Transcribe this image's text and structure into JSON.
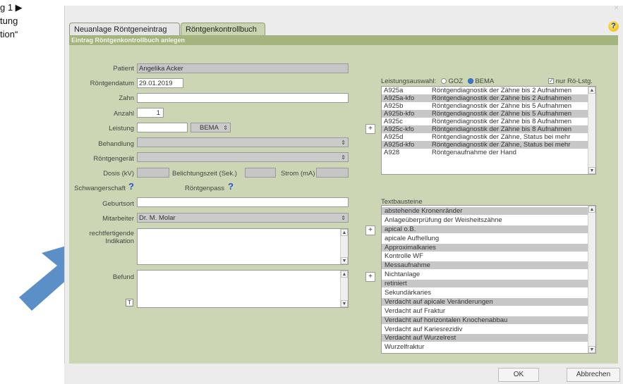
{
  "side_text": {
    "line1": "g 1 ▶",
    "line2": "tung",
    "line3": "tion“"
  },
  "window": {
    "close": "×",
    "help": "?"
  },
  "tabs": [
    {
      "label": "Neuanlage Röntgeneintrag"
    },
    {
      "label": "Röntgenkontrollbuch"
    }
  ],
  "panel_title": "Eintrag Röntgenkontrollbuch anlegen",
  "form": {
    "patient_label": "Patient",
    "patient_value": "Angelika Acker",
    "date_label": "Röntgendatum",
    "date_value": "29.01.2019",
    "zahn_label": "Zahn",
    "zahn_value": "",
    "anzahl_label": "Anzahl",
    "anzahl_value": "1",
    "leistung_label": "Leistung",
    "leistung_value": "",
    "leistung_catalog": "BEMA",
    "behandlung_label": "Behandlung",
    "geraet_label": "Röntgengerät",
    "dosis_label": "Dosis (kV)",
    "belichtung_label": "Belichtungszeit (Sek.)",
    "strom_label": "Strom (mA)",
    "schwanger_label": "Schwangerschaft",
    "pass_label": "Röntgenpass",
    "geburtsort_label": "Geburtsort",
    "geburtsort_value": "",
    "mitarbeiter_label": "Mitarbeiter",
    "mitarbeiter_value": "Dr. M. Molar",
    "indikation_label1": "rechtfertigende",
    "indikation_label2": "Indikation",
    "befund_label": "Befund",
    "t_button": "T",
    "arrow_symbol": "⇕",
    "question_symbol": "?",
    "plus_symbol": "+"
  },
  "leistungsauswahl": {
    "label": "Leistungsauswahl:",
    "goz": "GOZ",
    "bema": "BEMA",
    "filter": "nur Rö-Lstg.",
    "check_mark": "✓",
    "items": [
      {
        "code": "A925a",
        "desc": "Röntgendiagnostik der Zähne bis 2 Aufnahmen"
      },
      {
        "code": "A925a-kfo",
        "desc": "Röntgendiagnostik der Zähne bis 2 Aufnahmen"
      },
      {
        "code": "A925b",
        "desc": "Röntgendiagnostik der Zähne bis 5 Aufnahmen"
      },
      {
        "code": "A925b-kfo",
        "desc": "Röntgendiagnostik der Zähne bis 5 Aufnahmen"
      },
      {
        "code": "A925c",
        "desc": "Röntgendiagnostik der Zähne bis 8 Aufnahmen"
      },
      {
        "code": "A925c-kfo",
        "desc": "Röntgendiagnostik der Zähne bis 8 Aufnahmen"
      },
      {
        "code": "A925d",
        "desc": "Röntgendiagnostik der Zähne, Status bei mehr"
      },
      {
        "code": "A925d-kfo",
        "desc": "Röntgendiagnostik der Zähne, Status bei mehr"
      },
      {
        "code": "A928",
        "desc": "Röntgenaufnahme der Hand"
      }
    ]
  },
  "textbausteine": {
    "label": "Textbausteine",
    "items": [
      "abstehende Kronenränder",
      "Anlageüberprüfung der Weisheitszähne",
      "apical o.B.",
      "apicale Aufhellung",
      "Approximalkaries",
      "Kontrolle WF",
      "Messaufnahme",
      "Nichtanlage",
      "retiniert",
      "Sekundärkaries",
      "Verdacht auf apicale Veränderungen",
      "Verdacht auf Fraktur",
      "Verdacht auf horizontalen Knochenabbau",
      "Verdacht auf Kariesrezidiv",
      "Verdacht auf Wurzelrest",
      "Wurzelfraktur"
    ]
  },
  "buttons": {
    "ok": "OK",
    "cancel": "Abbrechen"
  },
  "scroll": {
    "up": "▲",
    "down": "▼"
  },
  "colors": {
    "panel": "#ccd6b4",
    "panel_header": "#a3b47e",
    "arrow": "#5b8fc7"
  }
}
